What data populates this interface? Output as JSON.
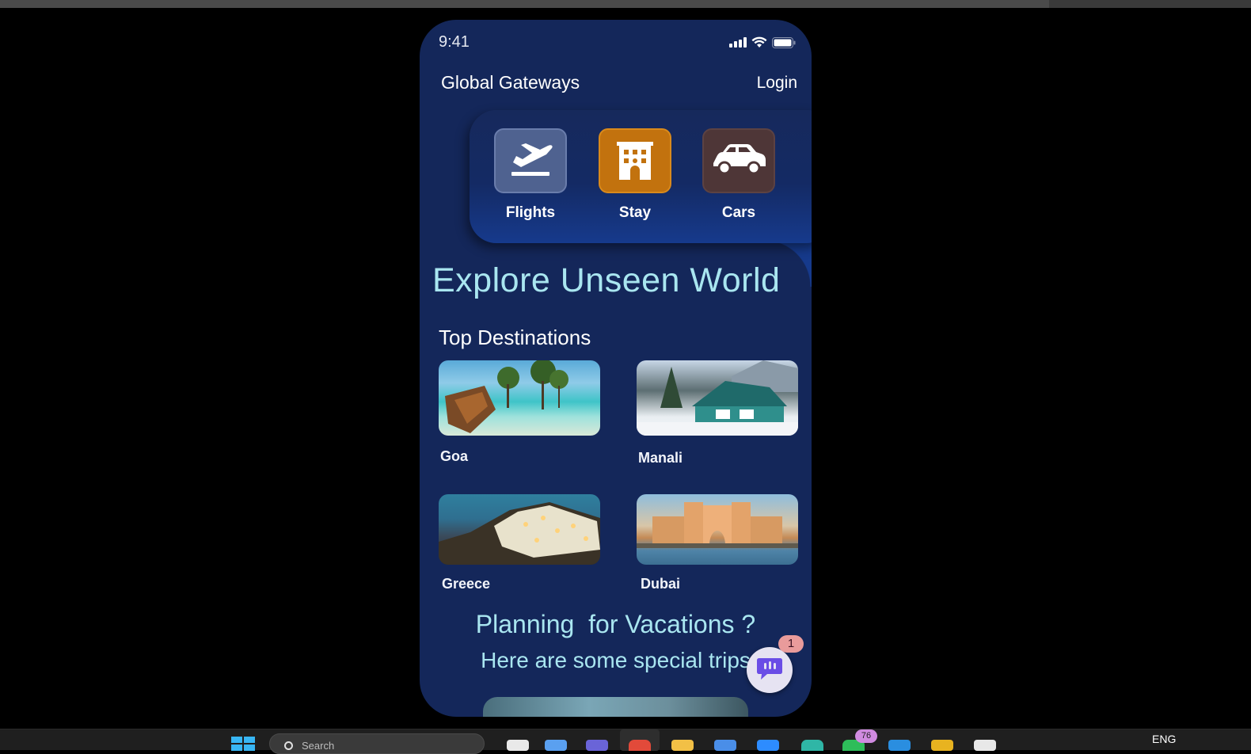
{
  "status_bar": {
    "time": "9:41"
  },
  "header": {
    "app_title": "Global Gateways",
    "login_label": "Login"
  },
  "services": [
    {
      "label": "Flights",
      "icon": "airplane-icon",
      "color": "#4f6290"
    },
    {
      "label": "Stay",
      "icon": "hotel-icon",
      "color": "#c2720e"
    },
    {
      "label": "Cars",
      "icon": "car-icon",
      "color": "#4e3637"
    }
  ],
  "hero": {
    "title": "Explore Unseen World"
  },
  "destinations": {
    "title": "Top Destinations",
    "items": [
      {
        "name": "Goa"
      },
      {
        "name": "Manali"
      },
      {
        "name": "Greece"
      },
      {
        "name": "Dubai"
      }
    ]
  },
  "promo": {
    "title": "Planning  for Vacations ?",
    "subtitle": "Here are some special trips"
  },
  "chat": {
    "badge_count": "1",
    "icon": "chat-icon"
  },
  "taskbar": {
    "search_placeholder": "Search",
    "notification_count": "76",
    "language": "ENG"
  },
  "colors": {
    "background": "#14275a",
    "accent_text": "#a9e6f0"
  }
}
